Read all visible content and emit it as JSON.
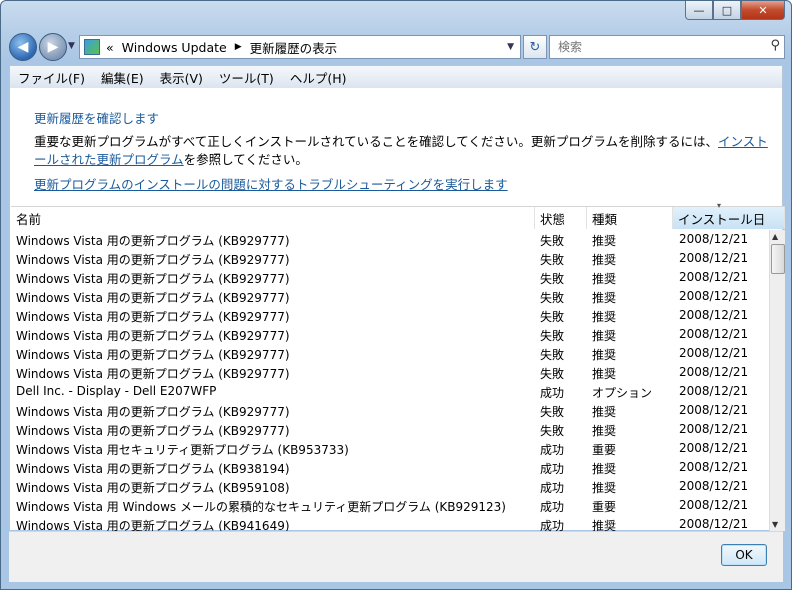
{
  "window": {
    "controls": {
      "minimize": "—",
      "maximize": "□",
      "close": "✕"
    }
  },
  "navigation": {
    "back_glyph": "◀",
    "forward_glyph": "▶",
    "breadcrumb": {
      "prefix": "«",
      "items": [
        "Windows Update",
        "更新履歴の表示"
      ],
      "separator": "▶"
    },
    "search_placeholder": "検索"
  },
  "menu": [
    "ファイル(F)",
    "編集(E)",
    "表示(V)",
    "ツール(T)",
    "ヘルプ(H)"
  ],
  "page": {
    "title": "更新履歴を確認します",
    "desc_before": "重要な更新プログラムがすべて正しくインストールされていることを確認してください。更新プログラムを削除するには、",
    "desc_link": "インストールされた更新プログラム",
    "desc_after": "を参照してください。",
    "troubleshoot_link": "更新プログラムのインストールの問題に対するトラブルシューティングを実行します"
  },
  "table": {
    "columns": [
      "名前",
      "状態",
      "種類",
      "インストール日"
    ],
    "rows": [
      [
        "Windows Vista 用の更新プログラム (KB929777)",
        "失敗",
        "推奨",
        "2008/12/21"
      ],
      [
        "Windows Vista 用の更新プログラム (KB929777)",
        "失敗",
        "推奨",
        "2008/12/21"
      ],
      [
        "Windows Vista 用の更新プログラム (KB929777)",
        "失敗",
        "推奨",
        "2008/12/21"
      ],
      [
        "Windows Vista 用の更新プログラム (KB929777)",
        "失敗",
        "推奨",
        "2008/12/21"
      ],
      [
        "Windows Vista 用の更新プログラム (KB929777)",
        "失敗",
        "推奨",
        "2008/12/21"
      ],
      [
        "Windows Vista 用の更新プログラム (KB929777)",
        "失敗",
        "推奨",
        "2008/12/21"
      ],
      [
        "Windows Vista 用の更新プログラム (KB929777)",
        "失敗",
        "推奨",
        "2008/12/21"
      ],
      [
        "Windows Vista 用の更新プログラム (KB929777)",
        "失敗",
        "推奨",
        "2008/12/21"
      ],
      [
        "Dell Inc. - Display - Dell E207WFP",
        "成功",
        "オプション",
        "2008/12/21"
      ],
      [
        "Windows Vista 用の更新プログラム (KB929777)",
        "失敗",
        "推奨",
        "2008/12/21"
      ],
      [
        "Windows Vista 用の更新プログラム (KB929777)",
        "失敗",
        "推奨",
        "2008/12/21"
      ],
      [
        "Windows Vista 用セキュリティ更新プログラム (KB953733)",
        "成功",
        "重要",
        "2008/12/21"
      ],
      [
        "Windows Vista 用の更新プログラム (KB938194)",
        "成功",
        "推奨",
        "2008/12/21"
      ],
      [
        "Windows Vista 用の更新プログラム (KB959108)",
        "成功",
        "推奨",
        "2008/12/21"
      ],
      [
        "Windows Vista 用 Windows メールの累積的なセキュリティ更新プログラム (KB929123)",
        "成功",
        "重要",
        "2008/12/21"
      ],
      [
        "Windows Vista 用の更新プログラム (KB941649)",
        "成功",
        "推奨",
        "2008/12/21"
      ]
    ]
  },
  "footer": {
    "ok_label": "OK"
  }
}
